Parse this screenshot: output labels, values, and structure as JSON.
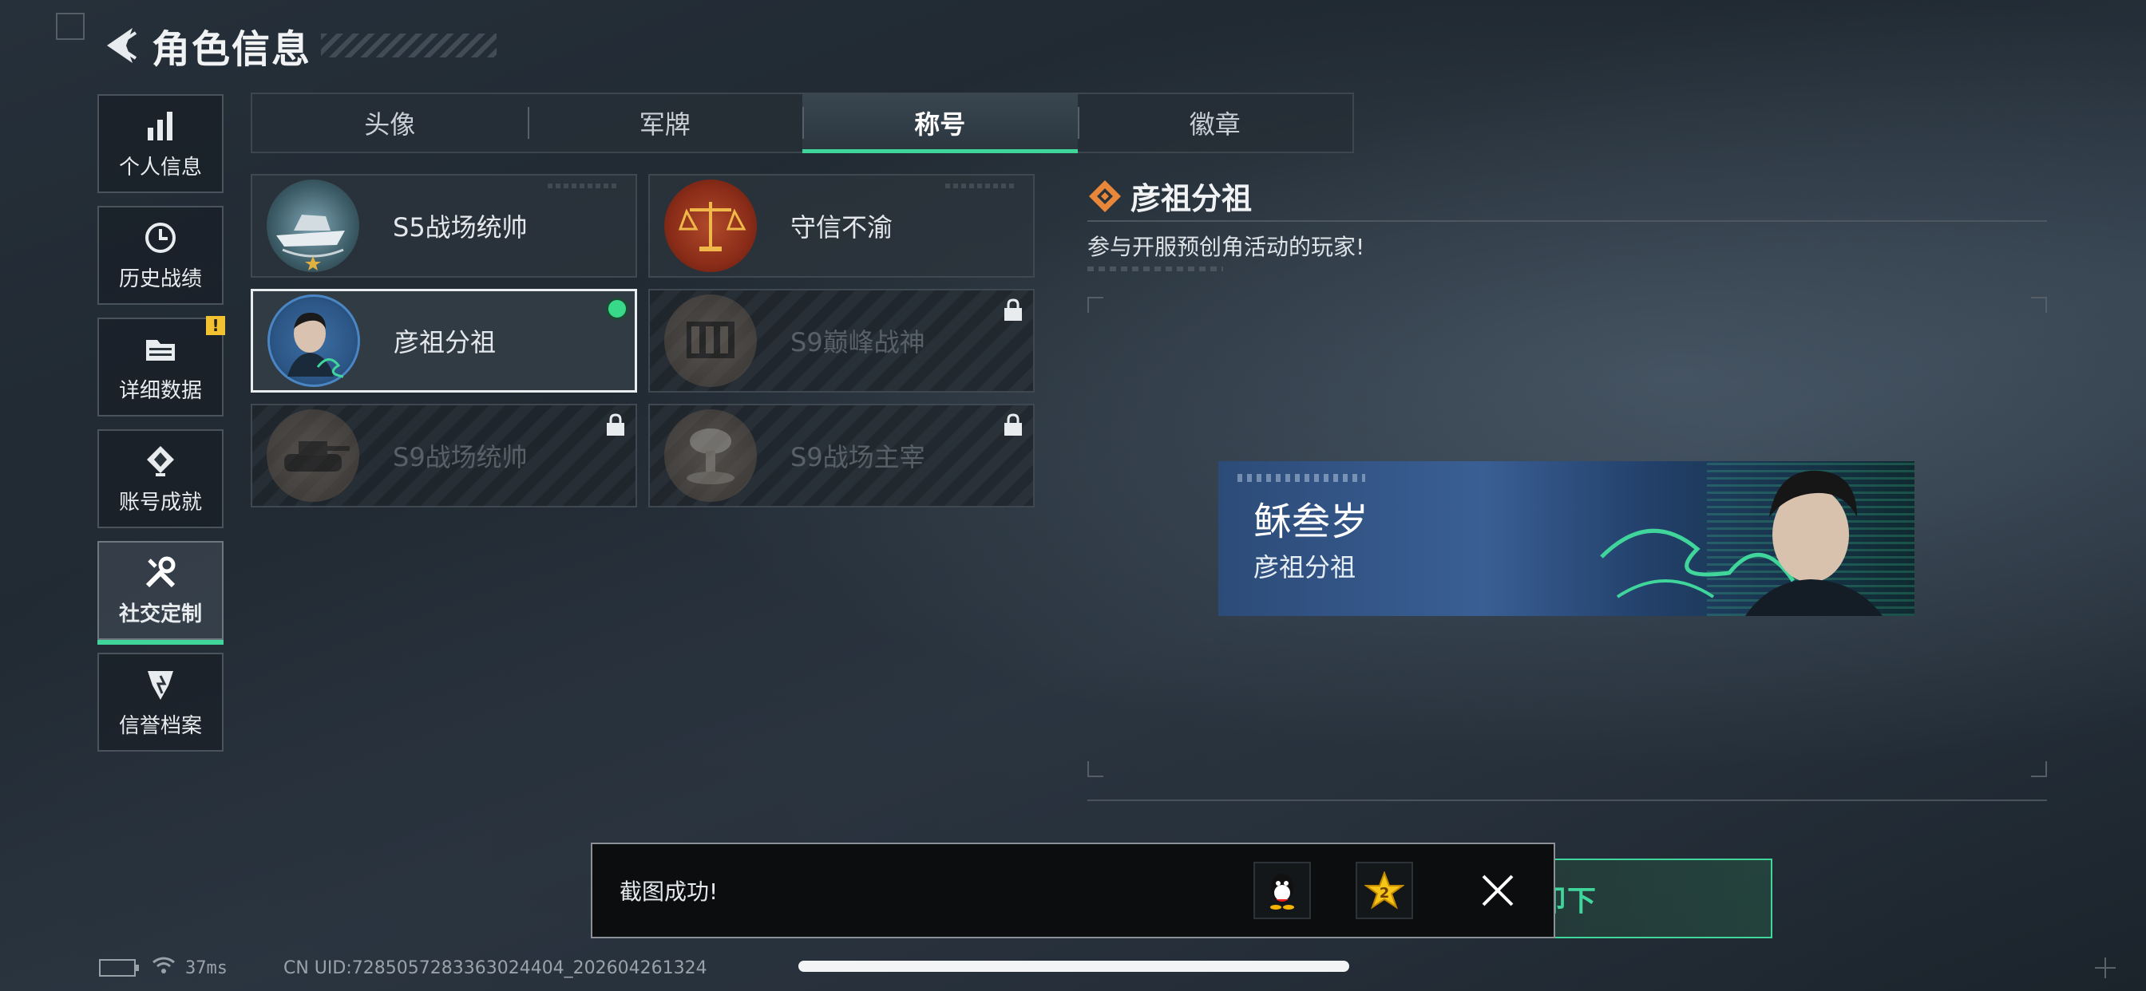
{
  "header": {
    "title": "角色信息"
  },
  "sidebar": {
    "items": [
      {
        "label": "个人信息",
        "icon": "bar-chart-icon"
      },
      {
        "label": "历史战绩",
        "icon": "history-clock-icon"
      },
      {
        "label": "详细数据",
        "icon": "folder-icon",
        "badge": "!"
      },
      {
        "label": "账号成就",
        "icon": "achievement-icon"
      },
      {
        "label": "社交定制",
        "icon": "tools-icon",
        "active": true
      },
      {
        "label": "信誉档案",
        "icon": "credit-shield-icon"
      }
    ]
  },
  "tabs": [
    {
      "label": "头像"
    },
    {
      "label": "军牌"
    },
    {
      "label": "称号",
      "active": true
    },
    {
      "label": "徽章"
    }
  ],
  "titles": [
    {
      "label": "S5战场统帅",
      "icon": "yacht-emblem-icon",
      "locked": false
    },
    {
      "label": "守信不渝",
      "icon": "scales-emblem-icon",
      "locked": false
    },
    {
      "label": "彦祖分祖",
      "icon": "portrait-emblem-icon",
      "locked": false,
      "selected": true
    },
    {
      "label": "S9巅峰战神",
      "icon": "fortress-emblem-icon",
      "locked": true
    },
    {
      "label": "S9战场统帅",
      "icon": "tank-emblem-icon",
      "locked": true
    },
    {
      "label": "S9战场主宰",
      "icon": "explosion-emblem-icon",
      "locked": true
    }
  ],
  "detail": {
    "title": "彦祖分祖",
    "description": "参与开服预创角活动的玩家!"
  },
  "banner": {
    "player_name": "稣叁岁",
    "title": "彦祖分祖"
  },
  "toast": {
    "message": "截图成功!",
    "share_targets": [
      "qq-icon",
      "qzone-star-icon"
    ]
  },
  "actions": {
    "unequip_label": "卸下"
  },
  "status_bar": {
    "ping": "37ms",
    "uid": "CN UID:7285057283363024404_202604261324"
  },
  "colors": {
    "accent": "#3fd59b",
    "banner_blue": "#3a5f94",
    "warning": "#f2c230"
  }
}
